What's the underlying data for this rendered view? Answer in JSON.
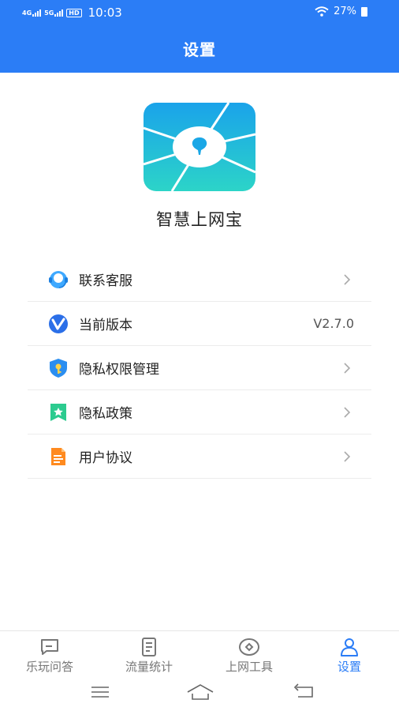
{
  "status": {
    "net1": "4G",
    "net2": "5G",
    "hd": "HD",
    "time": "10:03",
    "battery": "27%"
  },
  "header": {
    "title": "设置"
  },
  "app": {
    "name": "智慧上网宝"
  },
  "menu": {
    "items": [
      {
        "label": "联系客服",
        "icon": "customer-service-icon"
      },
      {
        "label": "当前版本",
        "icon": "version-icon",
        "value": "V2.7.0"
      },
      {
        "label": "隐私权限管理",
        "icon": "privacy-shield-icon"
      },
      {
        "label": "隐私政策",
        "icon": "privacy-policy-icon"
      },
      {
        "label": "用户协议",
        "icon": "user-agreement-icon"
      }
    ]
  },
  "tabs": [
    {
      "label": "乐玩问答",
      "icon": "chat-icon"
    },
    {
      "label": "流量统计",
      "icon": "document-icon"
    },
    {
      "label": "上网工具",
      "icon": "eye-icon"
    },
    {
      "label": "设置",
      "icon": "person-icon",
      "active": true
    }
  ],
  "colors": {
    "primary": "#2b7df6",
    "logo_blue": "#1ba8e8",
    "logo_teal": "#2ad2c9"
  }
}
